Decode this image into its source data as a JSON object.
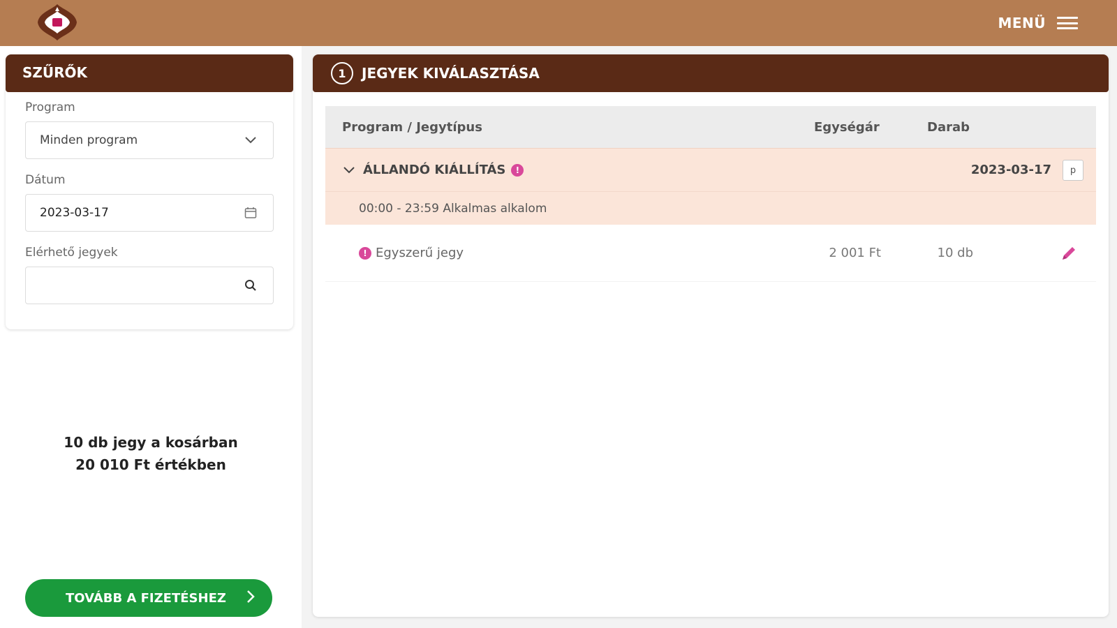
{
  "header": {
    "menu_label": "MENÜ",
    "logo_icon": "theatre-logo-icon",
    "accent_color": "#b57d52"
  },
  "sidebar": {
    "title": "SZŰRŐK",
    "program": {
      "label": "Program",
      "value": "Minden program"
    },
    "date": {
      "label": "Dátum",
      "value": "2023-03-17"
    },
    "tickets": {
      "label": "Elérhető jegyek",
      "value": "",
      "placeholder": ""
    },
    "cart": {
      "line1": "10 db jegy a kosárban",
      "line2": "20 010 Ft értékben"
    },
    "next_button": "TOVÁBB A FIZETÉSHEZ"
  },
  "main": {
    "step_number": "1",
    "title": "JEGYEK KIVÁLASZTÁSA",
    "table": {
      "headers": {
        "program": "Program / Jegytípus",
        "price": "Egységár",
        "qty": "Darab"
      },
      "group": {
        "title": "ÁLLANDÓ KIÁLLÍTÁS",
        "info": "!",
        "date": "2023-03-17",
        "button": "p",
        "slot": "00:00 - 23:59 Alkalmas alkalom",
        "tickets": [
          {
            "name": "Egyszerű jegy",
            "info": "!",
            "price": "2 001 Ft",
            "qty": "10 db"
          }
        ]
      }
    }
  },
  "colors": {
    "dark_brown": "#5a2a16",
    "highlight": "#fbe5d9",
    "green": "#1a9a3c",
    "pink": "#d9489a"
  }
}
